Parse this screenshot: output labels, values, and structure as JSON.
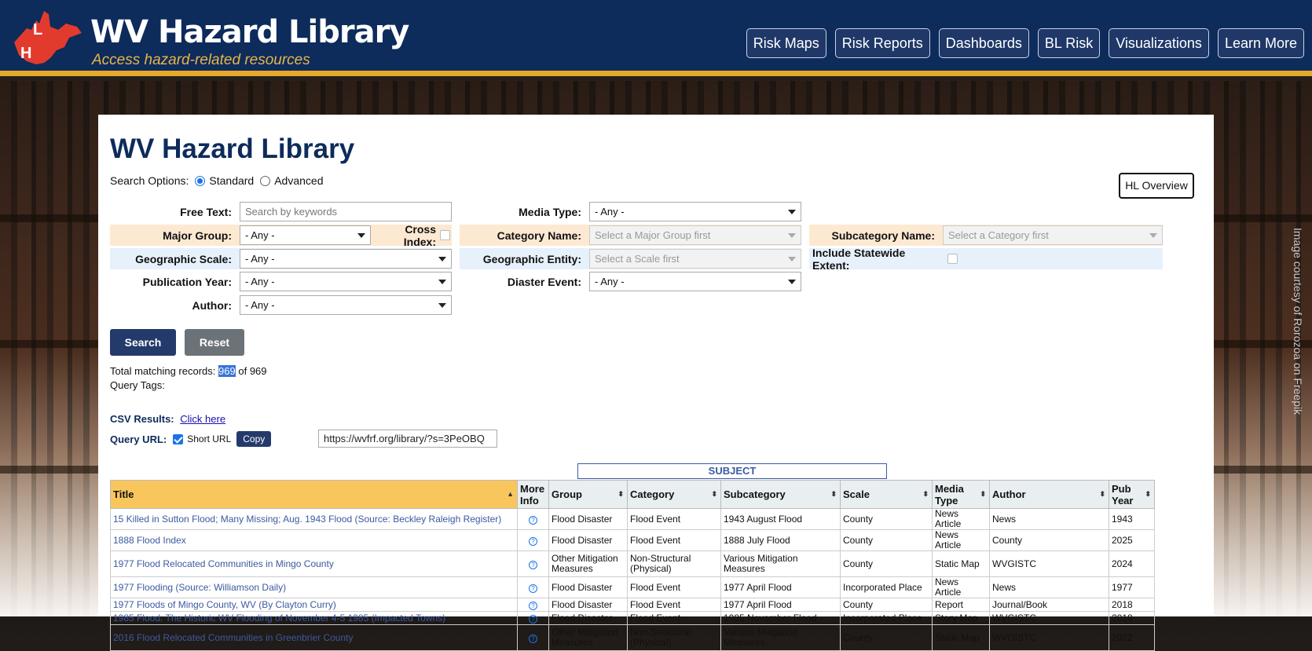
{
  "header": {
    "brand_title": "WV Hazard Library",
    "brand_tagline": "Access hazard-related resources",
    "nav": [
      "Risk Maps",
      "Risk Reports",
      "Dashboards",
      "BL Risk",
      "Visualizations",
      "Learn More"
    ]
  },
  "credit": "Image courtesy of Rorozoa on Freepik",
  "page_title": "WV Hazard Library",
  "search_options": {
    "label": "Search Options:",
    "standard": "Standard",
    "advanced": "Advanced",
    "selected": "Standard"
  },
  "overview_button": "HL Overview",
  "form": {
    "free_text_label": "Free Text:",
    "free_text_placeholder": "Search by keywords",
    "media_type_label": "Media Type:",
    "media_type_value": "- Any -",
    "major_group_label": "Major Group:",
    "major_group_value": "- Any -",
    "cross_index_label": "Cross Index:",
    "category_label": "Category Name:",
    "category_value": "Select a Major Group first",
    "subcategory_label": "Subcategory Name:",
    "subcategory_value": "Select a Category first",
    "geo_scale_label": "Geographic Scale:",
    "geo_scale_value": "- Any -",
    "geo_entity_label": "Geographic Entity:",
    "geo_entity_value": "Select a Scale first",
    "statewide_label": "Include Statewide Extent:",
    "pub_year_label": "Publication Year:",
    "pub_year_value": "- Any -",
    "disaster_label": "Diaster Event:",
    "disaster_value": "- Any -",
    "author_label": "Author:",
    "author_value": "- Any -"
  },
  "buttons": {
    "search": "Search",
    "reset": "Reset"
  },
  "records": {
    "label": "Total matching records:",
    "matching": "969",
    "of_text": "of 969"
  },
  "query_tags_label": "Query Tags:",
  "csv": {
    "label": "CSV Results:",
    "link": "Click here"
  },
  "query_url": {
    "label": "Query URL:",
    "short_label": "Short URL",
    "copy": "Copy",
    "url": "https://wvfrf.org/library/?s=3PeOBQ"
  },
  "subject_header": "SUBJECT",
  "table": {
    "columns": [
      "Title",
      "More Info",
      "Group",
      "Category",
      "Subcategory",
      "Scale",
      "Media Type",
      "Author",
      "Pub Year"
    ],
    "rows": [
      {
        "title": "15 Killed in Sutton Flood; Many Missing; Aug. 1943 Flood (Source: Beckley Raleigh Register)",
        "group": "Flood Disaster",
        "category": "Flood Event",
        "subcategory": "1943 August Flood",
        "scale": "County",
        "media": "News Article",
        "author": "News",
        "year": "1943"
      },
      {
        "title": "1888 Flood Index",
        "group": "Flood Disaster",
        "category": "Flood Event",
        "subcategory": "1888 July Flood",
        "scale": "County",
        "media": "News Article",
        "author": "County",
        "year": "2025"
      },
      {
        "title": "1977 Flood Relocated Communities in Mingo County",
        "group": "Other Mitigation Measures",
        "category": "Non-Structural (Physical)",
        "subcategory": "Various Mitigation Measures",
        "scale": "County",
        "media": "Static Map",
        "author": "WVGISTC",
        "year": "2024"
      },
      {
        "title": "1977 Flooding (Source: Williamson Daily)",
        "group": "Flood Disaster",
        "category": "Flood Event",
        "subcategory": "1977 April Flood",
        "scale": "Incorporated Place",
        "media": "News Article",
        "author": "News",
        "year": "1977"
      },
      {
        "title": "1977 Floods of Mingo County, WV (By Clayton Curry)",
        "group": "Flood Disaster",
        "category": "Flood Event",
        "subcategory": "1977 April Flood",
        "scale": "County",
        "media": "Report",
        "author": "Journal/Book",
        "year": "2018"
      },
      {
        "title": "1985 Flood: The Historic WV Flooding of November 4-5 1985 (Impacted Towns)",
        "group": "Flood Disaster",
        "category": "Flood Event",
        "subcategory": "1985 November Flood",
        "scale": "Incorporated Place",
        "media": "Story Map",
        "author": "WVGISTC",
        "year": "2018"
      },
      {
        "title": "2016 Flood Relocated Communities in Greenbrier County",
        "group": "Other Mitigation Measures",
        "category": "Non-Structural (Physical)",
        "subcategory": "Various Mitigation Measures",
        "scale": "County",
        "media": "Static Map",
        "author": "WVGISTC",
        "year": "2022"
      }
    ]
  },
  "colors": {
    "header_bg": "#0d2b5b",
    "accent": "#e7a92a",
    "title_col": "#f9c65d"
  }
}
